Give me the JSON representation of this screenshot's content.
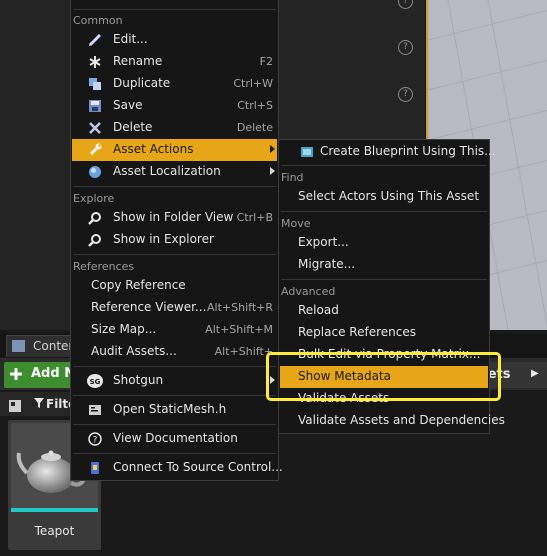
{
  "colors": {
    "menu_bg": "#161616",
    "highlight": "#e6a617",
    "callout": "#ffeb3b",
    "add_button": "#3e8e2f",
    "thumbnail_bar": "#26c7c9"
  },
  "background": {
    "content_tab_label": "Conten",
    "add_button_label": "Add N",
    "assets_button_label": "sets",
    "filter_label": "Filter",
    "asset_tile": {
      "name": "Teapot",
      "icon": "teapot-thumbnail"
    }
  },
  "context_menu": {
    "sections": {
      "common": "Common",
      "explore": "Explore",
      "references": "References"
    },
    "items": {
      "edit": {
        "label": "Edit...",
        "icon": "pencil-icon"
      },
      "rename": {
        "label": "Rename",
        "shortcut": "F2",
        "icon": "asterisk-icon"
      },
      "duplicate": {
        "label": "Duplicate",
        "shortcut": "Ctrl+W",
        "icon": "duplicate-icon"
      },
      "save": {
        "label": "Save",
        "shortcut": "Ctrl+S",
        "icon": "floppy-icon"
      },
      "delete": {
        "label": "Delete",
        "shortcut": "Delete",
        "icon": "x-icon"
      },
      "asset_actions": {
        "label": "Asset Actions",
        "icon": "wrench-icon"
      },
      "asset_localization": {
        "label": "Asset Localization",
        "icon": "globe-icon"
      },
      "show_in_folder_view": {
        "label": "Show in Folder View",
        "shortcut": "Ctrl+B",
        "icon": "magnifier-icon"
      },
      "show_in_explorer": {
        "label": "Show in Explorer",
        "icon": "magnifier-icon"
      },
      "copy_reference": {
        "label": "Copy Reference"
      },
      "reference_viewer": {
        "label": "Reference Viewer...",
        "shortcut": "Alt+Shift+R"
      },
      "size_map": {
        "label": "Size Map...",
        "shortcut": "Alt+Shift+M"
      },
      "audit_assets": {
        "label": "Audit Assets...",
        "shortcut": "Alt+Shift+"
      },
      "shotgun": {
        "label": "Shotgun",
        "icon": "shotgun-logo-icon"
      },
      "open_source": {
        "label": "Open StaticMesh.h",
        "icon": "code-icon"
      },
      "view_documentation": {
        "label": "View Documentation",
        "icon": "help-icon"
      },
      "connect_source_control": {
        "label": "Connect To Source Control...",
        "icon": "source-control-icon"
      }
    }
  },
  "asset_actions_menu": {
    "sections": {
      "find": "Find",
      "move": "Move",
      "advanced": "Advanced"
    },
    "items": {
      "create_blueprint": {
        "label": "Create Blueprint Using This...",
        "icon": "blueprint-icon"
      },
      "select_actors": {
        "label": "Select Actors Using This Asset"
      },
      "export": {
        "label": "Export..."
      },
      "migrate": {
        "label": "Migrate..."
      },
      "reload": {
        "label": "Reload"
      },
      "replace_references": {
        "label": "Replace References"
      },
      "bulk_edit": {
        "label": "Bulk Edit via Property Matrix..."
      },
      "show_metadata": {
        "label": "Show Metadata"
      },
      "validate_assets": {
        "label": "Validate Assets"
      },
      "validate_dependencies": {
        "label": "Validate Assets and Dependencies"
      }
    }
  }
}
